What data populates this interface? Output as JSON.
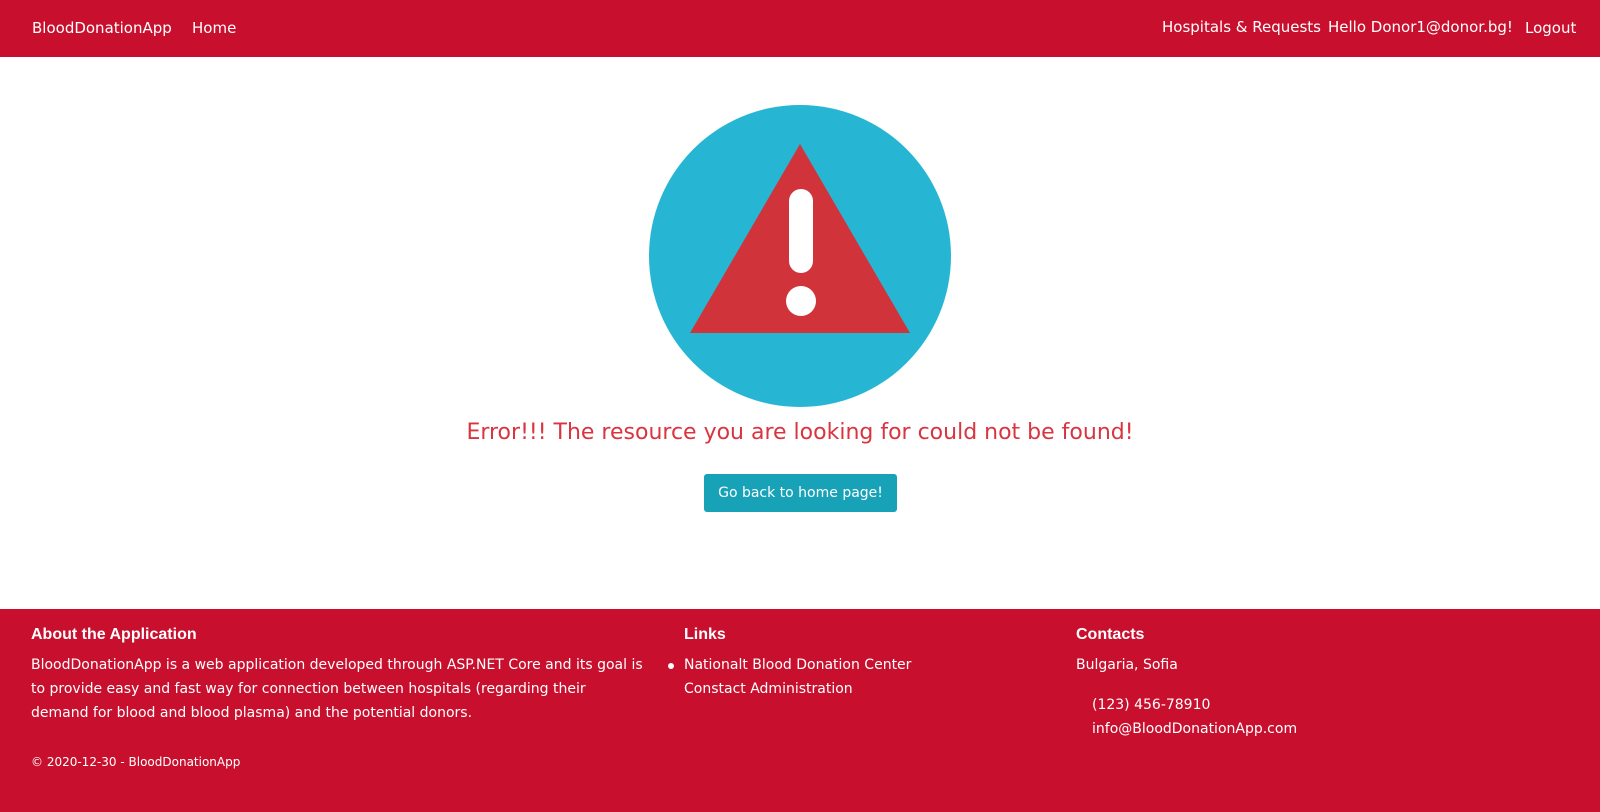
{
  "navbar": {
    "brand": "BloodDonationApp",
    "home": "Home",
    "hospitals_requests": "Hospitals & Requests",
    "greeting": "Hello Donor1@donor.bg!",
    "logout": "Logout"
  },
  "main": {
    "warning_icon": "warning-triangle-icon",
    "error_message": "Error!!! The resource you are looking for could not be found!",
    "home_button_label": "Go back to home page!"
  },
  "footer": {
    "about": {
      "title": "About the Application",
      "text": "BloodDonationApp is a web application developed through ASP.NET Core and its goal is to provide easy and fast way for connection between hospitals (regarding their demand for blood and blood plasma) and the potential donors."
    },
    "links": {
      "title": "Links",
      "items": [
        "Nationalt Blood Donation Center",
        "Constact Administration"
      ]
    },
    "contacts": {
      "title": "Contacts",
      "city": "Bulgaria, Sofia",
      "phone": "(123) 456-78910",
      "email": "info@BloodDonationApp.com"
    },
    "copyright": "© 2020-12-30 - BloodDonationApp"
  },
  "colors": {
    "primary_red": "#c8102e",
    "button_teal": "#17a2b8",
    "error_text": "#d9343f",
    "circle_blue": "#26b6d4"
  }
}
